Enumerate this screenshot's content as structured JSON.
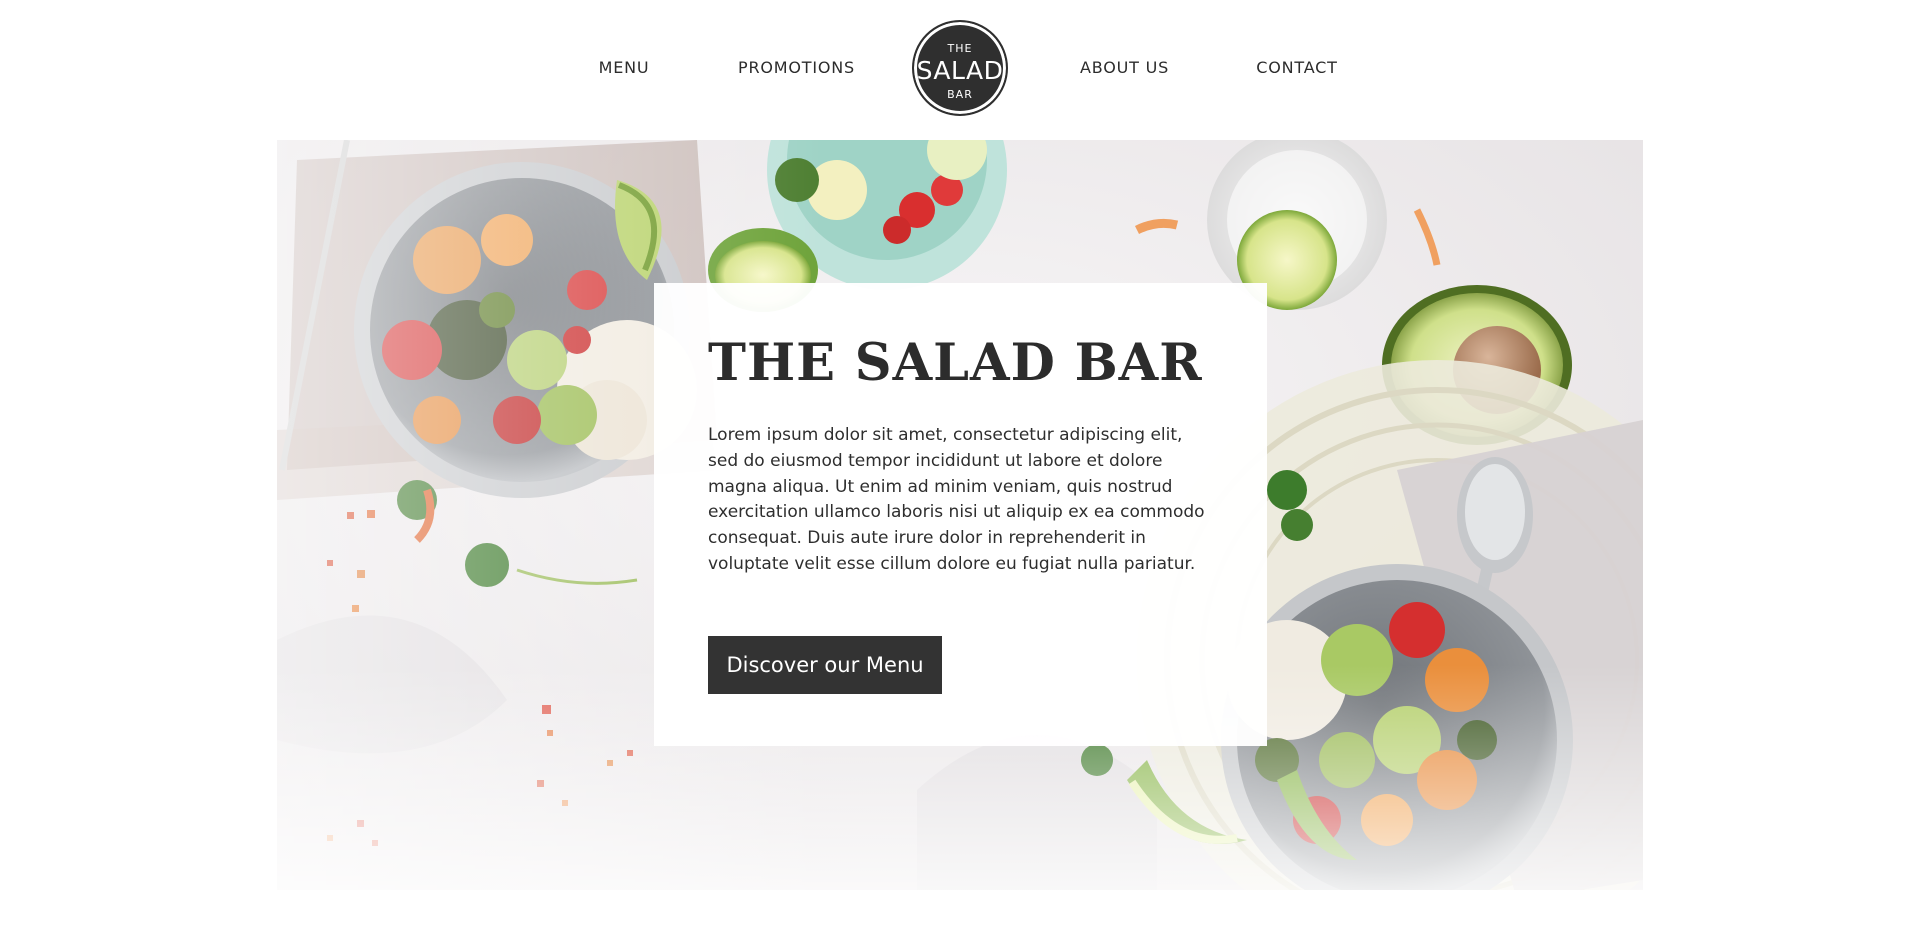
{
  "nav": {
    "menu_label": "MENU",
    "promotions_label": "PROMOTIONS",
    "about_label": "ABOUT US",
    "contact_label": "CONTACT"
  },
  "logo": {
    "top_text": "THE",
    "main_text": "SALAD",
    "bottom_text": "BAR",
    "background_color": "#2f2f2f"
  },
  "hero": {
    "image_icon": "salad-bowls-photo",
    "title": "THE SALAD BAR",
    "body": "Lorem ipsum dolor sit amet, consectetur adipiscing elit, sed do eiusmod tempor incididunt ut labore et dolore magna aliqua. Ut enim ad minim veniam, quis nostrud exercitation ullamco laboris nisi ut aliquip ex ea commodo consequat. Duis aute irure dolor in reprehenderit in voluptate velit esse cillum dolore eu fugiat nulla pariatur.",
    "cta_label": "Discover our Menu",
    "cta_color": "#333333"
  }
}
